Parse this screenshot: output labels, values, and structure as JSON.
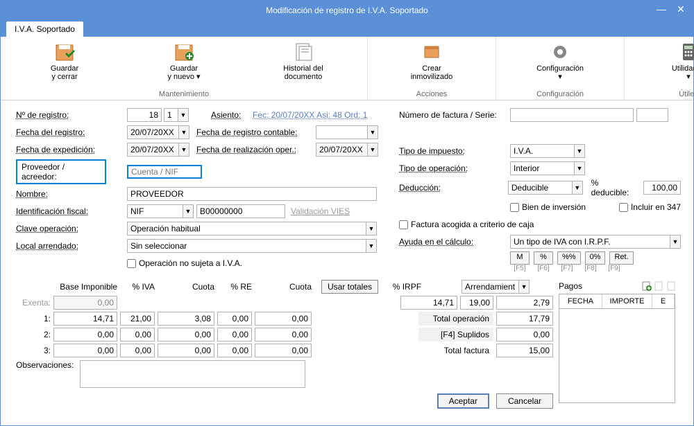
{
  "window": {
    "title": "Modificación de registro de I.V.A. Soportado"
  },
  "tab": "I.V.A. Soportado",
  "ribbon": {
    "mantenimiento": {
      "label": "Mantenimiento",
      "guardar_cerrar": "Guardar\ny cerrar",
      "guardar_nuevo": "Guardar\ny nuevo ▾",
      "historial": "Historial del\ndocumento"
    },
    "acciones": {
      "label": "Acciones",
      "crear_inmovilizado": "Crear\ninmovilizado"
    },
    "configuracion": {
      "label": "Configuración",
      "btn": "Configuración\n▾"
    },
    "utiles": {
      "label": "Útiles",
      "btn": "Utilidades\n▾"
    }
  },
  "left": {
    "nregistro_lbl": "Nº de registro:",
    "nregistro_val": "18",
    "nregistro_sub": "1",
    "asiento_lbl": "Asiento:",
    "asiento_val": "Fec: 20/07/20XX Asi: 48 Ord: 1",
    "fecha_registro_lbl": "Fecha del registro:",
    "fecha_registro_val": "20/07/20XX",
    "fecha_reg_contable_lbl": "Fecha de registro contable:",
    "fecha_reg_contable_val": "",
    "fecha_expedicion_lbl": "Fecha de expedición:",
    "fecha_expedicion_val": "20/07/20XX",
    "fecha_real_oper_lbl": "Fecha de realización oper.:",
    "fecha_real_oper_val": "20/07/20XX",
    "proveedor_lbl": "Proveedor / acreedor:",
    "proveedor_ph": "Cuenta / NIF",
    "nombre_lbl": "Nombre:",
    "nombre_val": "PROVEEDOR",
    "ident_fiscal_lbl": "Identificación fiscal:",
    "ident_tipo": "NIF",
    "ident_val": "B00000000",
    "validacion_vies": "Validación VIES",
    "clave_op_lbl": "Clave operación:",
    "clave_op_val": "Operación habitual",
    "local_arr_lbl": "Local arrendado:",
    "local_arr_val": "Sin seleccionar",
    "op_no_sujeta": "Operación no sujeta a I.V.A."
  },
  "right": {
    "nfactura_lbl": "Número de factura / Serie:",
    "tipo_imp_lbl": "Tipo de impuesto:",
    "tipo_imp_val": "I.V.A.",
    "tipo_op_lbl": "Tipo de operación:",
    "tipo_op_val": "Interior",
    "deduccion_lbl": "Deducción:",
    "deduccion_val": "Deducible",
    "pct_ded_lbl": "% deducible:",
    "pct_ded_val": "100,00",
    "bien_inversion": "Bien de inversión",
    "incluir_347": "Incluir en 347",
    "factura_caja": "Factura acogida a criterio de caja",
    "ayuda_lbl": "Ayuda en el cálculo:",
    "ayuda_val": "Un tipo de IVA con I.R.P.F.",
    "btns": {
      "m": "M",
      "pct": "%",
      "pctpct": "%%",
      "zero": "0%",
      "ret": "Ret."
    },
    "fkeys": {
      "f5": "[F5]",
      "f6": "[F6]",
      "f7": "[F7]",
      "f8": "[F8]",
      "f9": "[F9]"
    }
  },
  "grid": {
    "hdr": {
      "base": "Base Imponible",
      "pctiva": "% IVA",
      "cuota": "Cuota",
      "pctre": "% RE",
      "cuota2": "Cuota",
      "usar": "Usar totales",
      "pctirpf": "% IRPF",
      "arrend": "Arrendamient",
      "pagos": "Pagos"
    },
    "exenta_lbl": "Exenta:",
    "exenta_val": "0,00",
    "r1_lbl": "1:",
    "r1": {
      "base": "14,71",
      "pctiva": "21,00",
      "cuota": "3,08",
      "pctre": "0,00",
      "cuota2": "0,00"
    },
    "r2_lbl": "2:",
    "r2": {
      "base": "0,00",
      "pctiva": "0,00",
      "cuota": "0,00",
      "pctre": "0,00",
      "cuota2": "0,00"
    },
    "r3_lbl": "3:",
    "r3": {
      "base": "0,00",
      "pctiva": "0,00",
      "cuota": "0,00",
      "pctre": "0,00",
      "cuota2": "0,00"
    },
    "irpf_base": "14,71",
    "irpf_pct": "19,00",
    "irpf_cuota": "2,79",
    "total_op_lbl": "Total operación",
    "total_op_val": "17,79",
    "suplidos_lbl": "[F4] Suplidos",
    "suplidos_val": "0,00",
    "total_fact_lbl": "Total factura",
    "total_fact_val": "15,00",
    "obs_lbl": "Observaciones:",
    "pagoshdr": {
      "fecha": "FECHA",
      "importe": "IMPORTE",
      "e": "E"
    }
  },
  "footer": {
    "aceptar": "Aceptar",
    "cancelar": "Cancelar"
  }
}
